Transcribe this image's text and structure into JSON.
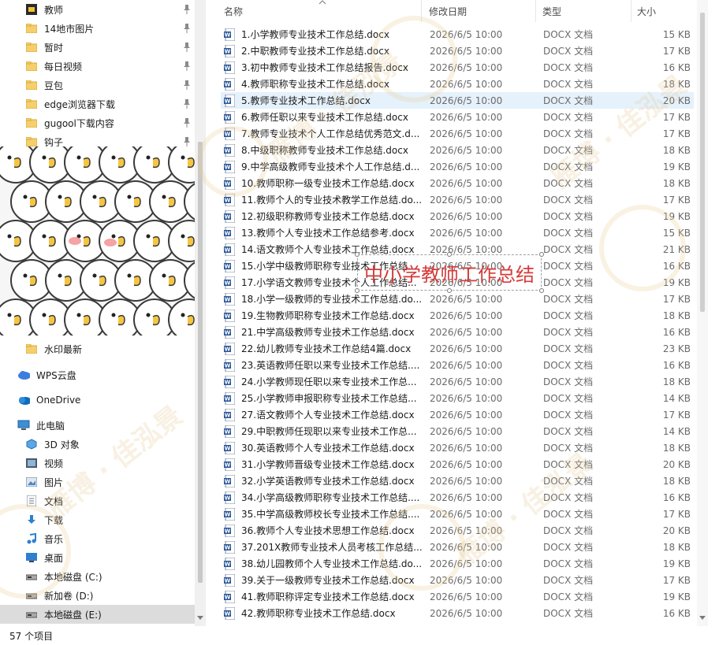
{
  "nav": {
    "quick_access": [
      {
        "label": "教师",
        "icon": "folder-dark-icon",
        "pinned": true
      },
      {
        "label": "14地市图片",
        "icon": "folder-icon",
        "pinned": true
      },
      {
        "label": "暂时",
        "icon": "folder-icon",
        "pinned": true
      },
      {
        "label": "每日视频",
        "icon": "folder-icon",
        "pinned": true
      },
      {
        "label": "豆包",
        "icon": "folder-icon",
        "pinned": true
      },
      {
        "label": "edge浏览器下载",
        "icon": "folder-icon",
        "pinned": true
      },
      {
        "label": "gugool下载内容",
        "icon": "folder-icon",
        "pinned": true
      },
      {
        "label": "钩子",
        "icon": "folder-icon",
        "pinned": true
      }
    ],
    "after_image": [
      {
        "label": "水印最新",
        "icon": "folder-icon",
        "indent": 1
      },
      {
        "label": "WPS云盘",
        "icon": "wps-cloud-icon",
        "indent": 0
      },
      {
        "label": "OneDrive",
        "icon": "onedrive-cloud-icon",
        "indent": 0
      },
      {
        "label": "此电脑",
        "icon": "computer-icon",
        "indent": 0
      },
      {
        "label": "3D 对象",
        "icon": "3d-objects-icon",
        "indent": 1
      },
      {
        "label": "视频",
        "icon": "video-icon",
        "indent": 1
      },
      {
        "label": "图片",
        "icon": "pictures-icon",
        "indent": 1
      },
      {
        "label": "文档",
        "icon": "documents-icon",
        "indent": 1
      },
      {
        "label": "下载",
        "icon": "download-icon",
        "indent": 1
      },
      {
        "label": "音乐",
        "icon": "music-icon",
        "indent": 1
      },
      {
        "label": "桌面",
        "icon": "desktop-icon",
        "indent": 1
      },
      {
        "label": "本地磁盘 (C:)",
        "icon": "drive-icon",
        "indent": 1
      },
      {
        "label": "新加卷 (D:)",
        "icon": "drive-icon",
        "indent": 1
      },
      {
        "label": "本地磁盘 (E:)",
        "icon": "drive-icon",
        "indent": 1,
        "selected": true
      }
    ]
  },
  "columns": {
    "name": "名称",
    "date": "修改日期",
    "type": "类型",
    "size": "大小"
  },
  "files": [
    {
      "name": "1.小学教师专业技术工作总结.docx",
      "date": "2026/6/5 10:00",
      "type": "DOCX 文档",
      "size": "15 KB"
    },
    {
      "name": "2.中职教师专业技术工作总结.docx",
      "date": "2026/6/5 10:00",
      "type": "DOCX 文档",
      "size": "17 KB"
    },
    {
      "name": "3.初中教师专业技术工作总结报告.docx",
      "date": "2026/6/5 10:00",
      "type": "DOCX 文档",
      "size": "16 KB"
    },
    {
      "name": "4.教师职称专业技术工作总结.docx",
      "date": "2026/6/5 10:00",
      "type": "DOCX 文档",
      "size": "18 KB"
    },
    {
      "name": "5.教师专业技术工作总结.docx",
      "date": "2026/6/5 10:00",
      "type": "DOCX 文档",
      "size": "20 KB",
      "selected": true
    },
    {
      "name": "6.教师任职以来专业技术工作总结.docx",
      "date": "2026/6/5 10:00",
      "type": "DOCX 文档",
      "size": "17 KB"
    },
    {
      "name": "7.教师专业技术个人工作总结优秀范文.d...",
      "date": "2026/6/5 10:00",
      "type": "DOCX 文档",
      "size": "17 KB"
    },
    {
      "name": "8.中级职称教师专业技术工作总结.docx",
      "date": "2026/6/5 10:00",
      "type": "DOCX 文档",
      "size": "18 KB"
    },
    {
      "name": "9.中学高级教师专业技术个人工作总结.d...",
      "date": "2026/6/5 10:00",
      "type": "DOCX 文档",
      "size": "19 KB"
    },
    {
      "name": "10.教师职称一级专业技术工作总结.docx",
      "date": "2026/6/5 10:00",
      "type": "DOCX 文档",
      "size": "18 KB"
    },
    {
      "name": "11.教师个人的专业技术教学工作总结.do...",
      "date": "2026/6/5 10:00",
      "type": "DOCX 文档",
      "size": "17 KB"
    },
    {
      "name": "12.初级职称教师专业技术工作总结.docx",
      "date": "2026/6/5 10:00",
      "type": "DOCX 文档",
      "size": "19 KB"
    },
    {
      "name": "13.教师个人专业技术工作总结参考.docx",
      "date": "2026/6/5 10:00",
      "type": "DOCX 文档",
      "size": "15 KB"
    },
    {
      "name": "14.语文教师个人专业技术工作总结.docx",
      "date": "2026/6/5 10:00",
      "type": "DOCX 文档",
      "size": "21 KB"
    },
    {
      "name": "15.小学中级教师职称专业技术工作总结...",
      "date": "2026/6/5 10:00",
      "type": "DOCX 文档",
      "size": "16 KB"
    },
    {
      "name": "17.小学语文教师专业技术个人工作总结...",
      "date": "2026/6/5 10:00",
      "type": "DOCX 文档",
      "size": "19 KB"
    },
    {
      "name": "18.小学一级教师的专业技术工作总结.do...",
      "date": "2026/6/5 10:00",
      "type": "DOCX 文档",
      "size": "17 KB"
    },
    {
      "name": "19.生物教师职称专业技术工作总结.docx",
      "date": "2026/6/5 10:00",
      "type": "DOCX 文档",
      "size": "18 KB"
    },
    {
      "name": "21.中学高级教师专业技术工作总结.docx",
      "date": "2026/6/5 10:00",
      "type": "DOCX 文档",
      "size": "16 KB"
    },
    {
      "name": "22.幼儿教师专业技术工作总结4篇.docx",
      "date": "2026/6/5 10:00",
      "type": "DOCX 文档",
      "size": "23 KB"
    },
    {
      "name": "23.英语教师任职以来专业技术工作总结....",
      "date": "2026/6/5 10:00",
      "type": "DOCX 文档",
      "size": "16 KB"
    },
    {
      "name": "24.小学教师现任职以来专业技术工作总...",
      "date": "2026/6/5 10:00",
      "type": "DOCX 文档",
      "size": "18 KB"
    },
    {
      "name": "25.小学教师申报职称专业技术工作总结...",
      "date": "2026/6/5 10:00",
      "type": "DOCX 文档",
      "size": "14 KB"
    },
    {
      "name": "27.语文教师个人专业技术工作总结.docx",
      "date": "2026/6/5 10:00",
      "type": "DOCX 文档",
      "size": "17 KB"
    },
    {
      "name": "29.中职教师任现职以来专业技术工作总...",
      "date": "2026/6/5 10:00",
      "type": "DOCX 文档",
      "size": "14 KB"
    },
    {
      "name": "30.英语教师个人专业技术工作总结.docx",
      "date": "2026/6/5 10:00",
      "type": "DOCX 文档",
      "size": "18 KB"
    },
    {
      "name": "31.小学教师晋级专业技术工作总结.docx",
      "date": "2026/6/5 10:00",
      "type": "DOCX 文档",
      "size": "20 KB"
    },
    {
      "name": "32.小学英语教师专业技术工作总结.docx",
      "date": "2026/6/5 10:00",
      "type": "DOCX 文档",
      "size": "18 KB"
    },
    {
      "name": "34.小学高级教师职称专业技术工作总结....",
      "date": "2026/6/5 10:00",
      "type": "DOCX 文档",
      "size": "16 KB"
    },
    {
      "name": "35.中学高级教师校长专业技术工作总结....",
      "date": "2026/6/5 10:00",
      "type": "DOCX 文档",
      "size": "17 KB"
    },
    {
      "name": "36.教师个人专业技术思想工作总结.docx",
      "date": "2026/6/5 10:00",
      "type": "DOCX 文档",
      "size": "20 KB"
    },
    {
      "name": "37.201X教师专业技术人员考核工作总结....",
      "date": "2026/6/5 10:00",
      "type": "DOCX 文档",
      "size": "18 KB"
    },
    {
      "name": "38.幼儿园教师个人专业技术工作总结.do...",
      "date": "2026/6/5 10:00",
      "type": "DOCX 文档",
      "size": "19 KB"
    },
    {
      "name": "39.关于一级教师专业技术工作总结.docx",
      "date": "2026/6/5 10:00",
      "type": "DOCX 文档",
      "size": "17 KB"
    },
    {
      "name": "41.教师职称评定专业技术工作总结.docx",
      "date": "2026/6/5 10:00",
      "type": "DOCX 文档",
      "size": "19 KB"
    },
    {
      "name": "42.教师职称专业技术工作总结.docx",
      "date": "2026/6/5 10:00",
      "type": "DOCX 文档",
      "size": "16 KB"
    }
  ],
  "status": {
    "item_count": "57 个项目"
  },
  "overlay": {
    "text": "中小学教师工作总结"
  },
  "watermark": {
    "text": "雁博 · 佳泓景"
  },
  "colors": {
    "selected_row": "#e5f1fb",
    "overlay_text": "#d63a3a",
    "word_icon": "#2b5797"
  }
}
